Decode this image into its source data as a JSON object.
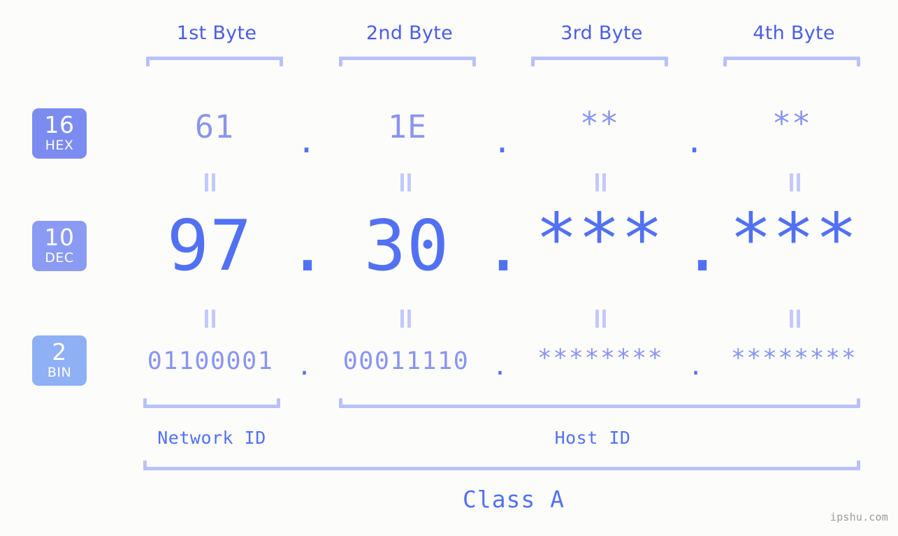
{
  "page": {
    "background_color": "#fcfdfa",
    "accent_color": "#5271f2",
    "muted_accent_color": "#8a95ee",
    "bracket_color": "#b9c1fb",
    "watermark": "ipshu.com"
  },
  "headers": {
    "byte1": "1st Byte",
    "byte2": "2nd Byte",
    "byte3": "3rd Byte",
    "byte4": "4th Byte"
  },
  "bases": [
    {
      "num": "16",
      "abbr": "HEX",
      "color": "#7b8bef"
    },
    {
      "num": "10",
      "abbr": "DEC",
      "color": "#8b9af2"
    },
    {
      "num": "2",
      "abbr": "BIN",
      "color": "#8fb0f5"
    }
  ],
  "rows": {
    "hex": {
      "base_num": "16",
      "base_abbr": "HEX",
      "values": [
        "61",
        "1E",
        "**",
        "**"
      ],
      "separator": "."
    },
    "dec": {
      "base_num": "10",
      "base_abbr": "DEC",
      "values": [
        "97",
        "30",
        "***",
        "***"
      ],
      "separator": "."
    },
    "bin": {
      "base_num": "2",
      "base_abbr": "BIN",
      "values": [
        "01100001",
        "00011110",
        "********",
        "********"
      ],
      "separator": "."
    }
  },
  "equals_marks": {
    "glyph": "=",
    "count": 8
  },
  "footer": {
    "network_id_label": "Network ID",
    "host_id_label": "Host ID",
    "class_label": "Class A"
  }
}
